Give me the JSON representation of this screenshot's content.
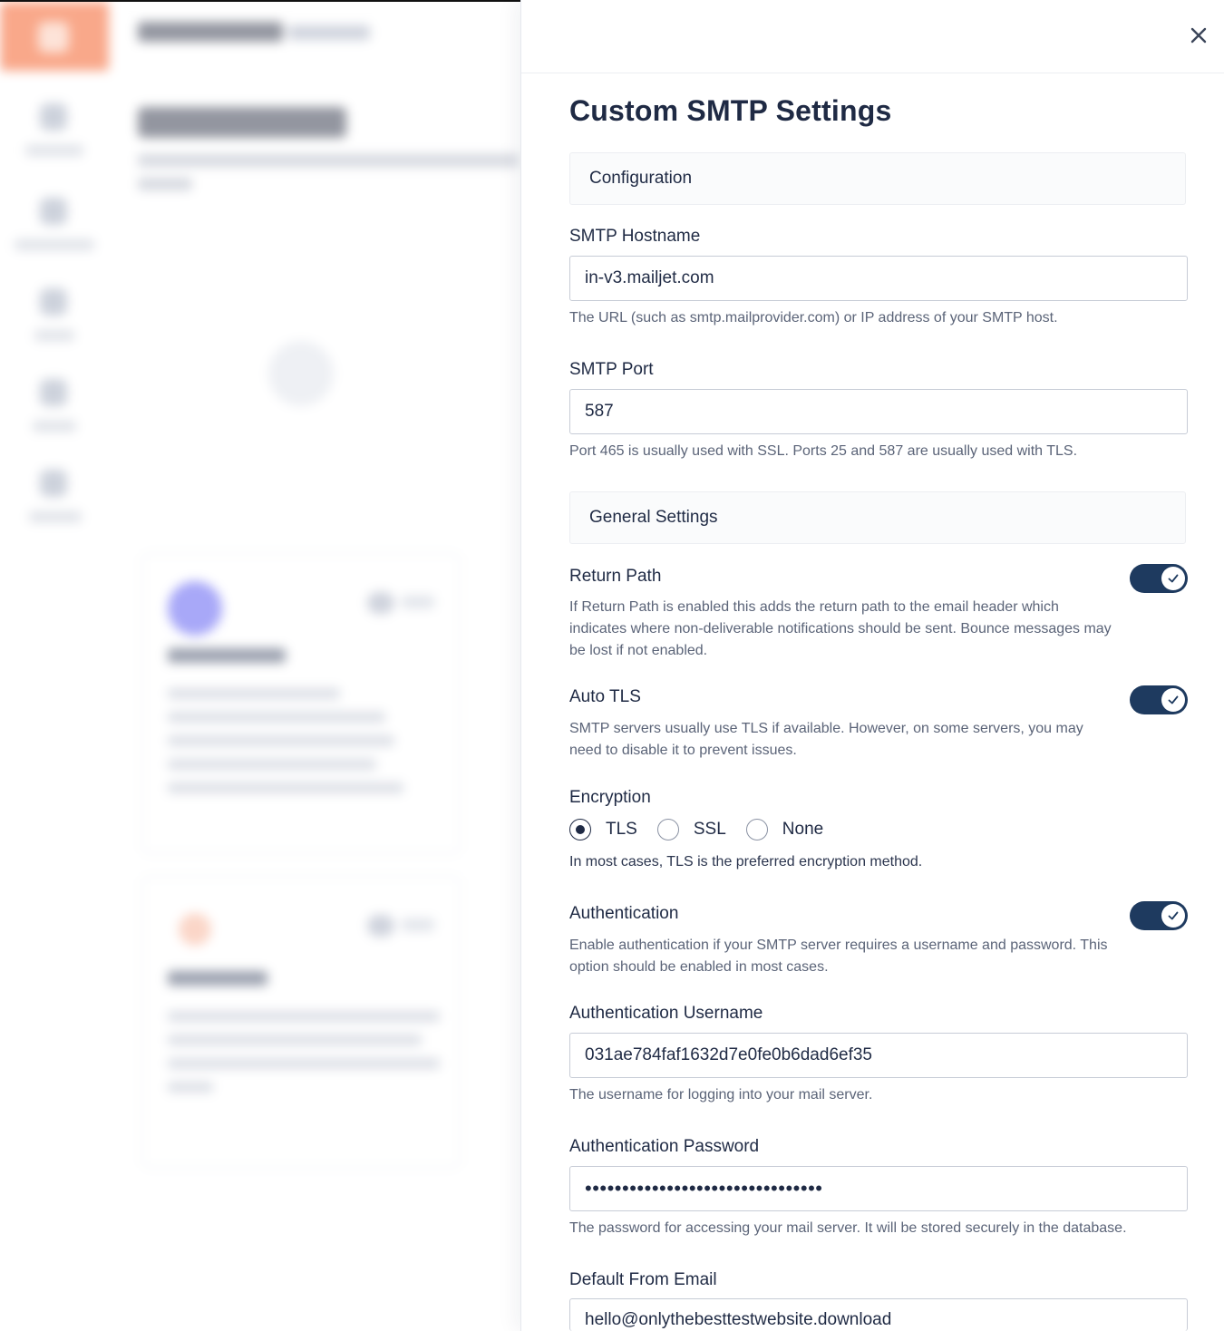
{
  "panel": {
    "title": "Custom SMTP Settings",
    "close_icon": "close-icon"
  },
  "configuration": {
    "section_title": "Configuration",
    "hostname": {
      "label": "SMTP Hostname",
      "value": "in-v3.mailjet.com",
      "help": "The URL (such as smtp.mailprovider.com) or IP address of your SMTP host."
    },
    "port": {
      "label": "SMTP Port",
      "value": "587",
      "help": "Port 465 is usually used with SSL. Ports 25 and 587 are usually used with TLS."
    }
  },
  "general": {
    "section_title": "General Settings",
    "return_path": {
      "label": "Return Path",
      "enabled": true,
      "help": "If Return Path is enabled this adds the return path to the email header which indicates where non-deliverable notifications should be sent. Bounce messages may be lost if not enabled."
    },
    "auto_tls": {
      "label": "Auto TLS",
      "enabled": true,
      "help": "SMTP servers usually use TLS if available. However, on some servers, you may need to disable it to prevent issues."
    },
    "encryption": {
      "label": "Encryption",
      "options": [
        "TLS",
        "SSL",
        "None"
      ],
      "selected": "TLS",
      "help": "In most cases, TLS is the preferred encryption method."
    },
    "authentication": {
      "label": "Authentication",
      "enabled": true,
      "help": "Enable authentication if your SMTP server requires a username and password. This option should be enabled in most cases."
    },
    "auth_username": {
      "label": "Authentication Username",
      "value": "031ae784faf1632d7e0fe0b6dad6ef35",
      "help": "The username for logging into your mail server."
    },
    "auth_password": {
      "label": "Authentication Password",
      "value": "••••••••••••••••••••••••••••••••",
      "help": "The password for accessing your mail server. It will be stored securely in the database."
    },
    "from_email": {
      "label": "Default From Email",
      "value": "hello@onlythebesttestwebsite.download"
    }
  },
  "colors": {
    "toggle_on": "#1e3a5f",
    "text_primary": "#1f2a44",
    "text_help": "#5b6478"
  }
}
